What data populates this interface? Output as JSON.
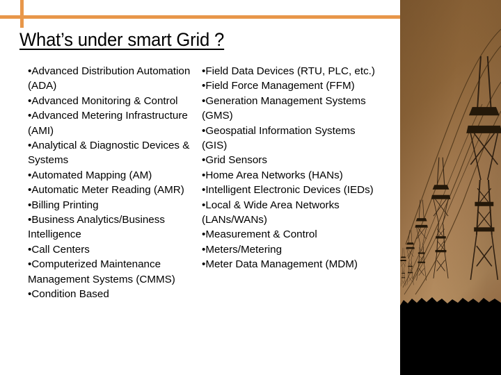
{
  "slide": {
    "title": "What’s under smart Grid ?",
    "accent_color": "#e8974a",
    "background_color": "#ffffff",
    "text_color": "#000000"
  },
  "content": {
    "left_column": [
      "•Advanced Distribution Automation (ADA)",
      "•Advanced Monitoring & Control",
      "•Advanced Metering Infrastructure (AMI)",
      "•Analytical & Diagnostic Devices & Systems",
      "•Automated Mapping (AM)",
      "•Automatic Meter Reading (AMR)",
      "•Billing Printing",
      "•Business Analytics/Business Intelligence",
      "•Call Centers",
      "•Computerized Maintenance Management Systems (CMMS)",
      "•Condition Based"
    ],
    "right_column": [
      "•Field Data Devices (RTU, PLC, etc.)",
      "•Field Force Management (FFM)",
      "•Generation Management Systems (GMS)",
      "•Geospatial Information Systems (GIS)",
      "•Grid Sensors",
      "•Home Area Networks (HANs)",
      "•Intelligent Electronic Devices (IEDs)",
      "•Local & Wide Area Networks (LANs/WANs)",
      "•Measurement & Control",
      "•Meters/Metering",
      "•Meter Data Management (MDM)"
    ]
  },
  "photo": {
    "description": "power-transmission-towers-at-dusk",
    "sky_top_color": "#8a6239",
    "sky_bottom_color": "#b58e61",
    "ground_color": "#000000",
    "tower_color": "#3a2716"
  }
}
